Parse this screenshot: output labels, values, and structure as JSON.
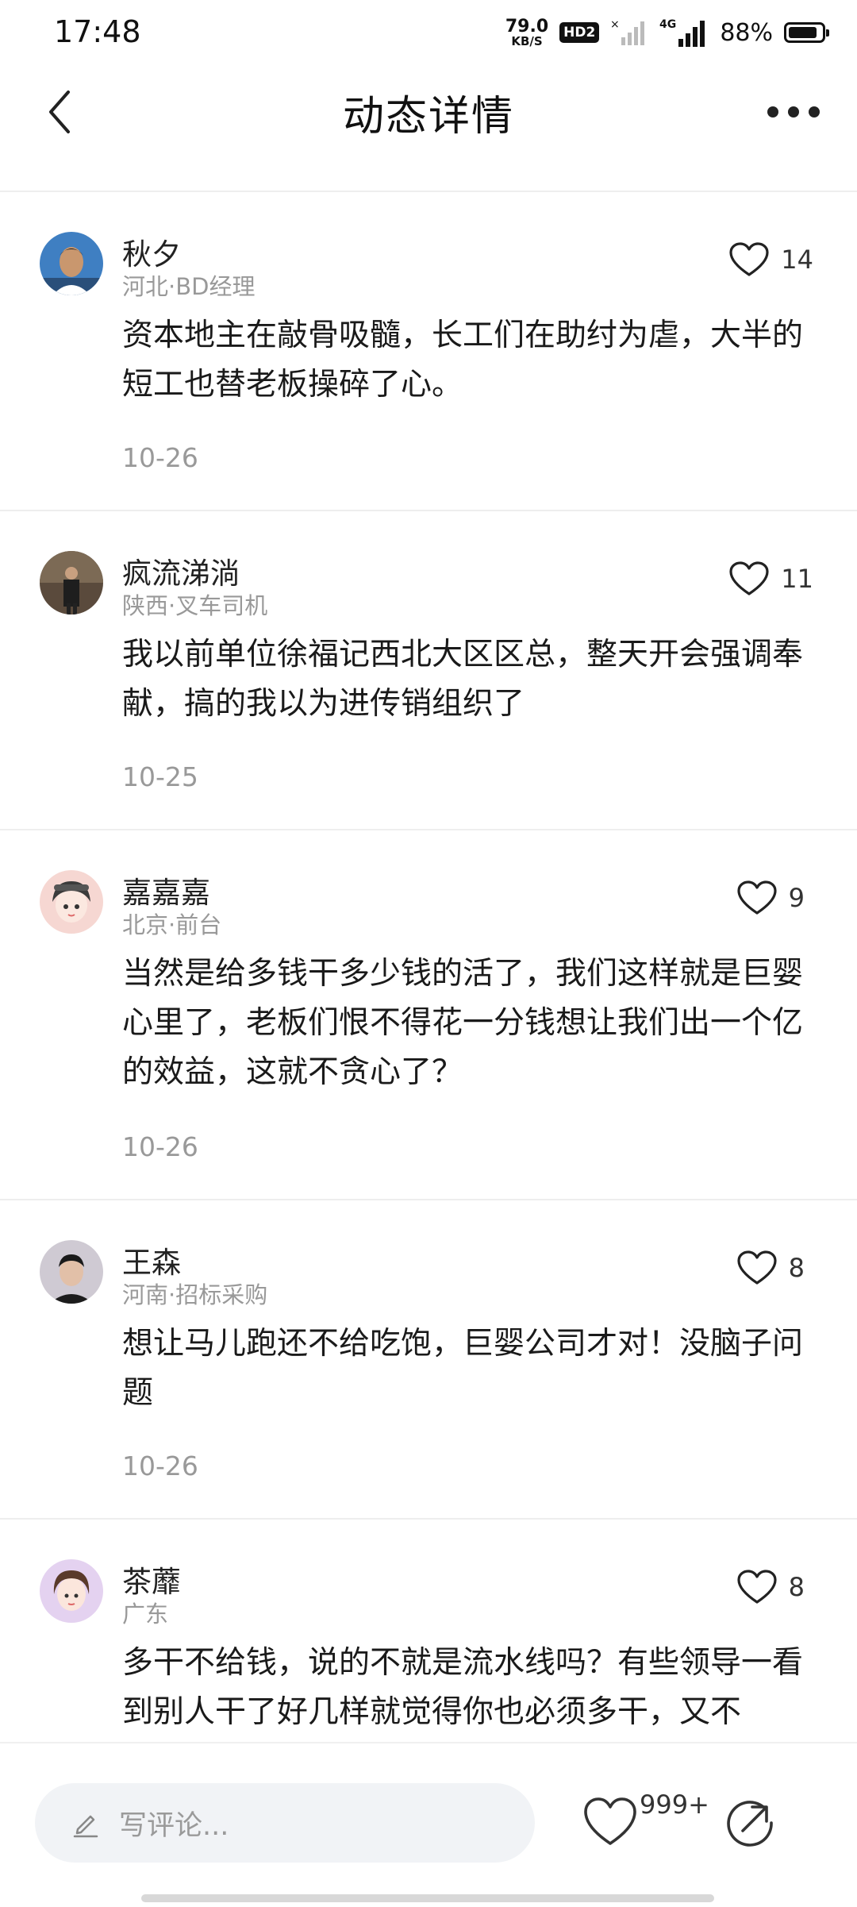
{
  "status_bar": {
    "time": "17:48",
    "net_speed_value": "79.0",
    "net_speed_unit": "KB/S",
    "hd_badge": "HD2",
    "network": "4G",
    "battery": "88%",
    "battery_level": 0.88
  },
  "header": {
    "title": "动态详情",
    "back_icon": "chevron-left-icon",
    "more_icon": "more-dots-icon"
  },
  "comments": [
    {
      "name": "秋夕",
      "meta": "河北·BD经理",
      "likes": "14",
      "text": "资本地主在敲骨吸髓，长工们在助纣为虐，大半的短工也替老板操碎了心。",
      "date": "10-26"
    },
    {
      "name": "疯流涕淌",
      "meta": "陕西·叉车司机",
      "likes": "11",
      "text": "我以前单位徐福记西北大区区总，整天开会强调奉献，搞的我以为进传销组织了",
      "date": "10-25"
    },
    {
      "name": "嘉嘉嘉",
      "meta": "北京·前台",
      "likes": "9",
      "text": "当然是给多钱干多少钱的活了，我们这样就是巨婴心里了，老板们恨不得花一分钱想让我们出一个亿的效益，这就不贪心了？",
      "date": "10-26"
    },
    {
      "name": "王森",
      "meta": "河南·招标采购",
      "likes": "8",
      "text": "想让马儿跑还不给吃饱，巨婴公司才对！没脑子问题",
      "date": "10-26"
    },
    {
      "name": "茶蘼",
      "meta": "广东",
      "likes": "8",
      "text": "多干不给钱，说的不就是流水线吗？有些领导一看到别人干了好几样就觉得你也必须多干，又不",
      "date": ""
    }
  ],
  "bottom_bar": {
    "input_placeholder": "写评论...",
    "like_count": "999+",
    "like_icon": "heart-icon",
    "share_icon": "share-icon"
  },
  "colors": {
    "text_primary": "#222222",
    "text_secondary": "#999999",
    "divider": "#eeeeee",
    "input_bg": "#f1f3f6"
  }
}
